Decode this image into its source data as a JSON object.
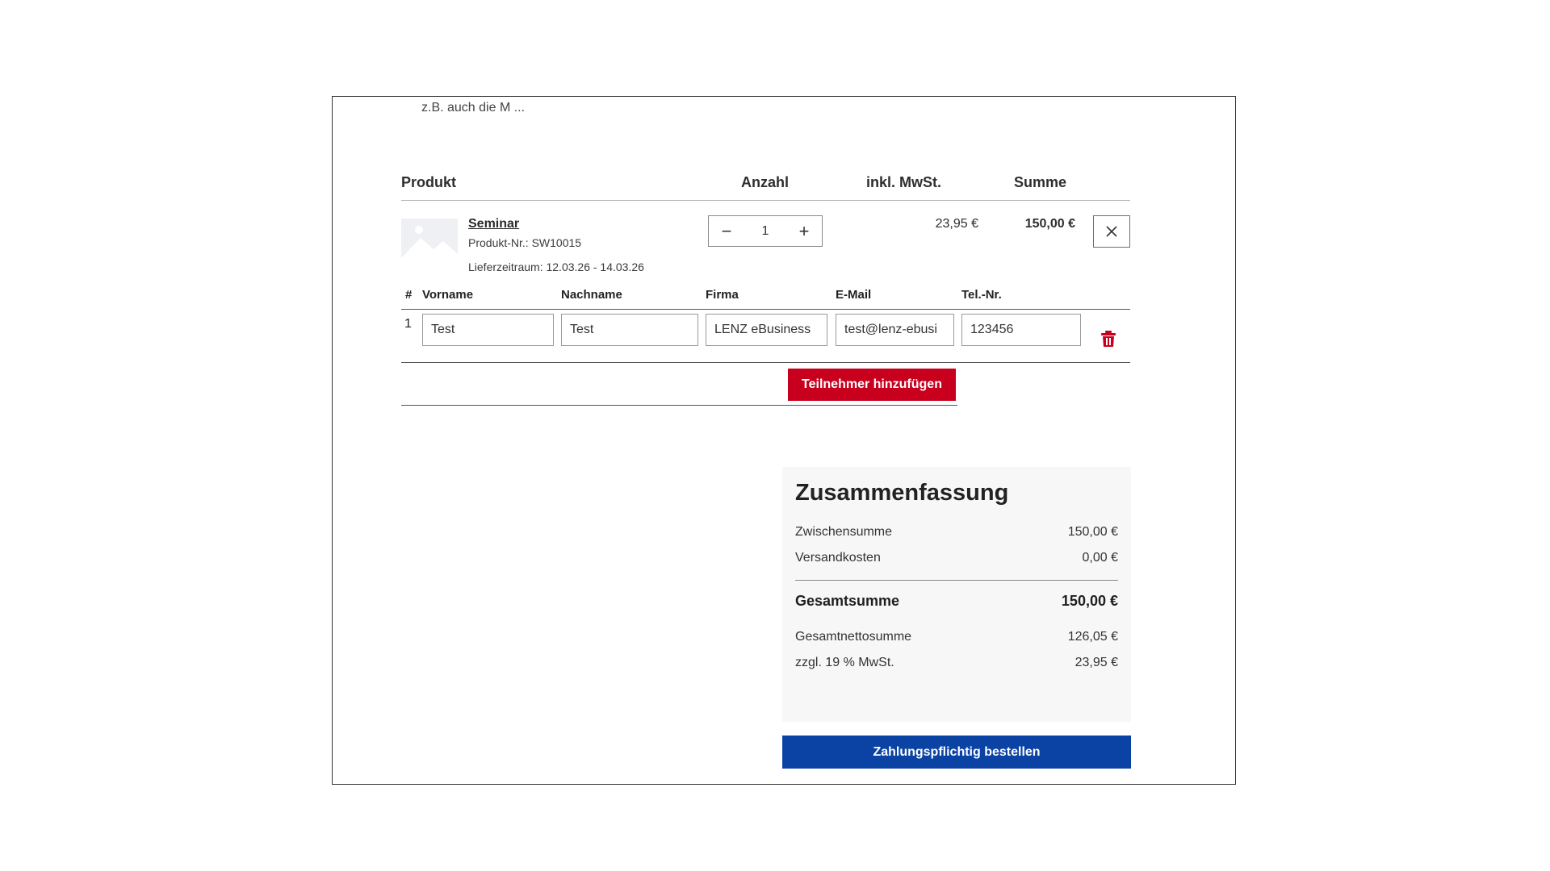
{
  "truncated_description": "z.B. auch die M ...",
  "cart_header": {
    "product": "Produkt",
    "quantity": "Anzahl",
    "vat": "inkl. MwSt.",
    "total": "Summe"
  },
  "line_item": {
    "name": "Seminar",
    "product_number": "Produkt-Nr.: SW10015",
    "delivery": "Lieferzeitraum: 12.03.26 - 14.03.26",
    "quantity": "1",
    "minus_label": "−",
    "plus_label": "+",
    "vat_amount": "23,95 €",
    "line_total": "150,00 €"
  },
  "participants": {
    "headers": {
      "number": "#",
      "first_name": "Vorname",
      "last_name": "Nachname",
      "company": "Firma",
      "email": "E-Mail",
      "phone": "Tel.-Nr."
    },
    "rows": [
      {
        "number": "1",
        "first_name": "Test",
        "last_name": "Test",
        "company": "LENZ eBusiness",
        "email": "test@lenz-ebusi",
        "phone": "123456"
      }
    ],
    "add_label": "Teilnehmer hinzufügen"
  },
  "summary": {
    "title": "Zusammenfassung",
    "subtotal_label": "Zwischensumme",
    "subtotal_value": "150,00 €",
    "shipping_label": "Versandkosten",
    "shipping_value": "0,00 €",
    "grand_total_label": "Gesamtsumme",
    "grand_total_value": "150,00 €",
    "net_total_label": "Gesamtnettosumme",
    "net_total_value": "126,05 €",
    "tax_label": "zzgl. 19 % MwSt.",
    "tax_value": "23,95 €"
  },
  "order_button": "Zahlungspflichtig bestellen",
  "colors": {
    "accent_red": "#c8001e",
    "accent_blue": "#0b43a4",
    "summary_bg": "#f7f7f7"
  }
}
